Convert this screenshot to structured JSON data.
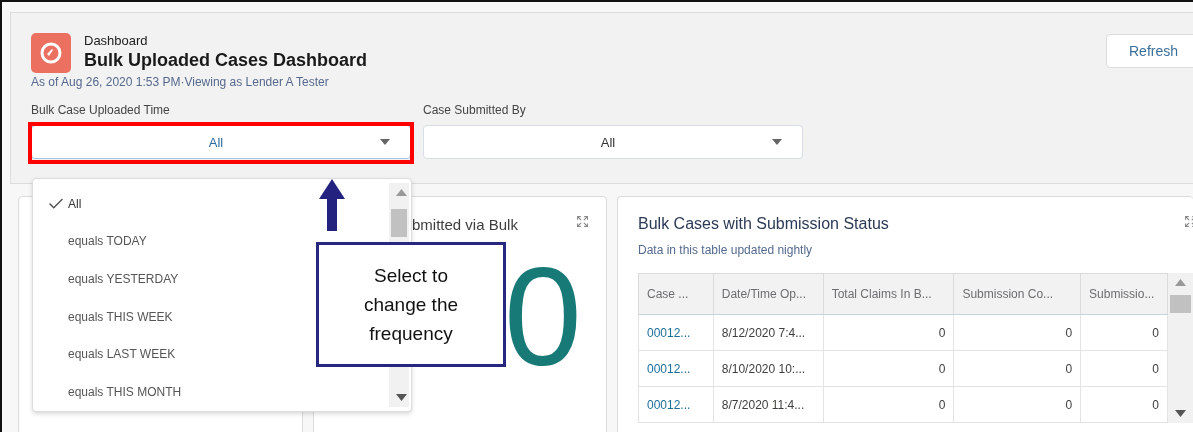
{
  "header": {
    "object_type": "Dashboard",
    "title": "Bulk Uploaded Cases Dashboard",
    "subtitle": "As of Aug 26, 2020 1:53 PM·Viewing as Lender A Tester",
    "refresh_button": "Refresh"
  },
  "filters": [
    {
      "label": "Bulk Case Uploaded Time",
      "value": "All",
      "open": true,
      "highlighted": true
    },
    {
      "label": "Case Submitted By",
      "value": "All",
      "open": false,
      "highlighted": false
    }
  ],
  "dropdown": {
    "options": [
      {
        "label": "All",
        "selected": true
      },
      {
        "label": "equals TODAY",
        "selected": false
      },
      {
        "label": "equals YESTERDAY",
        "selected": false
      },
      {
        "label": "equals THIS WEEK",
        "selected": false
      },
      {
        "label": "equals LAST WEEK",
        "selected": false
      },
      {
        "label": "equals THIS MONTH",
        "selected": false
      }
    ]
  },
  "metric_widget": {
    "title": "bmitted via Bulk",
    "value": "0"
  },
  "table_widget": {
    "title": "Bulk Cases with Submission Status",
    "subtitle": "Data in this table updated nightly",
    "columns": [
      "Case ...",
      "Date/Time Op...",
      "Total Claims In B...",
      "Submission Co...",
      "Submissio..."
    ],
    "rows": [
      [
        "00012...",
        "8/12/2020 7:4...",
        "0",
        "0",
        "0"
      ],
      [
        "00012...",
        "8/10/2020 10:...",
        "0",
        "0",
        "0"
      ],
      [
        "00012...",
        "8/7/2020 11:4...",
        "0",
        "0",
        "0"
      ]
    ]
  },
  "annotation": {
    "text": "Select to change the frequency"
  }
}
